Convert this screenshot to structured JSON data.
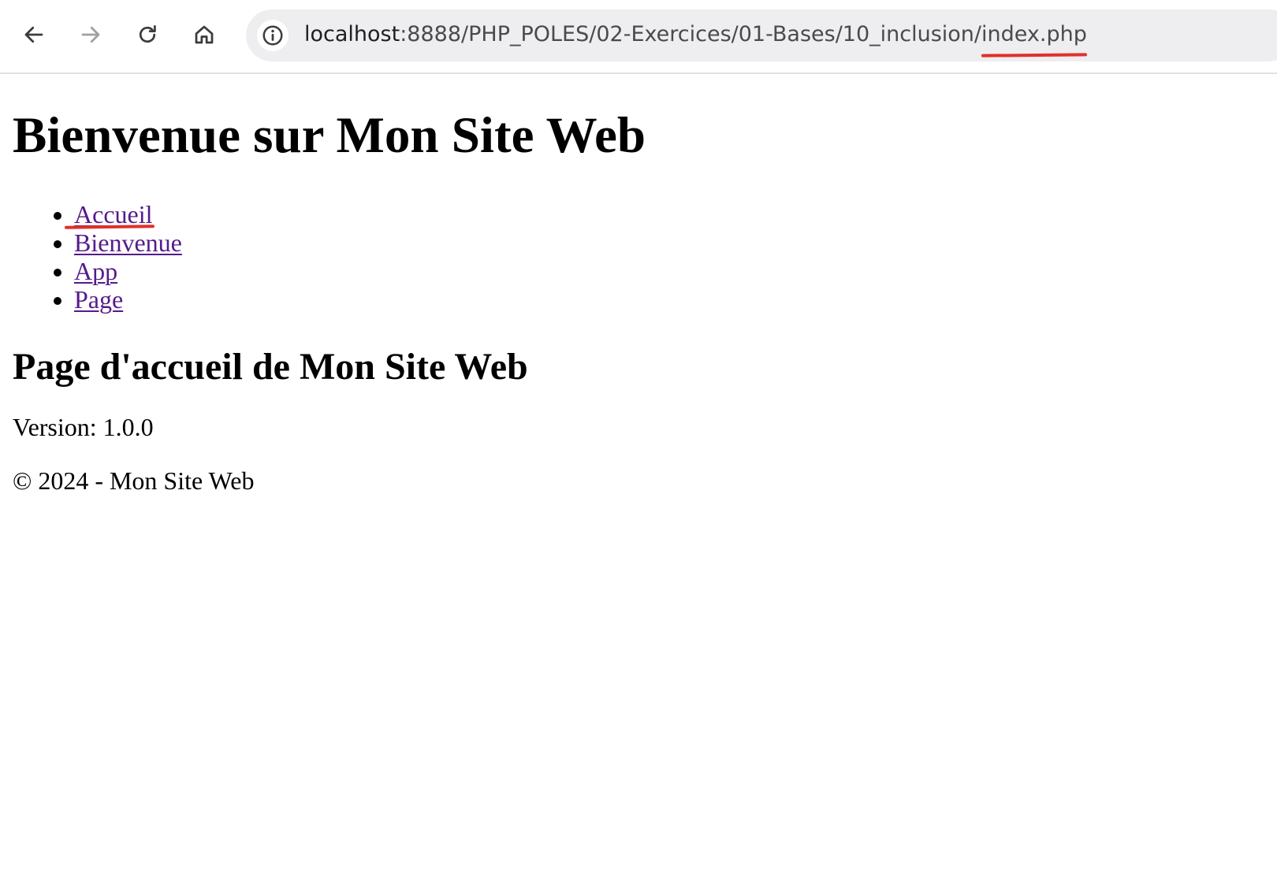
{
  "browser": {
    "url_host": "localhost",
    "url_path": ":8888/PHP_POLES/02-Exercices/01-Bases/10_inclusion/",
    "url_file": "index.php",
    "buttons": [
      "back-icon",
      "forward-icon",
      "reload-icon",
      "home-icon",
      "site-info-icon"
    ]
  },
  "page": {
    "title": "Bienvenue sur Mon Site Web",
    "nav": [
      {
        "label": "Accueil"
      },
      {
        "label": "Bienvenue"
      },
      {
        "label": "App"
      },
      {
        "label": "Page"
      }
    ],
    "subtitle": "Page d'accueil de Mon Site Web",
    "version": "Version: 1.0.0",
    "footer": "© 2024 - Mon Site Web"
  },
  "colors": {
    "link": "#551a8b",
    "annotation": "#e0302a",
    "address_bar_bg": "#eeedef"
  }
}
